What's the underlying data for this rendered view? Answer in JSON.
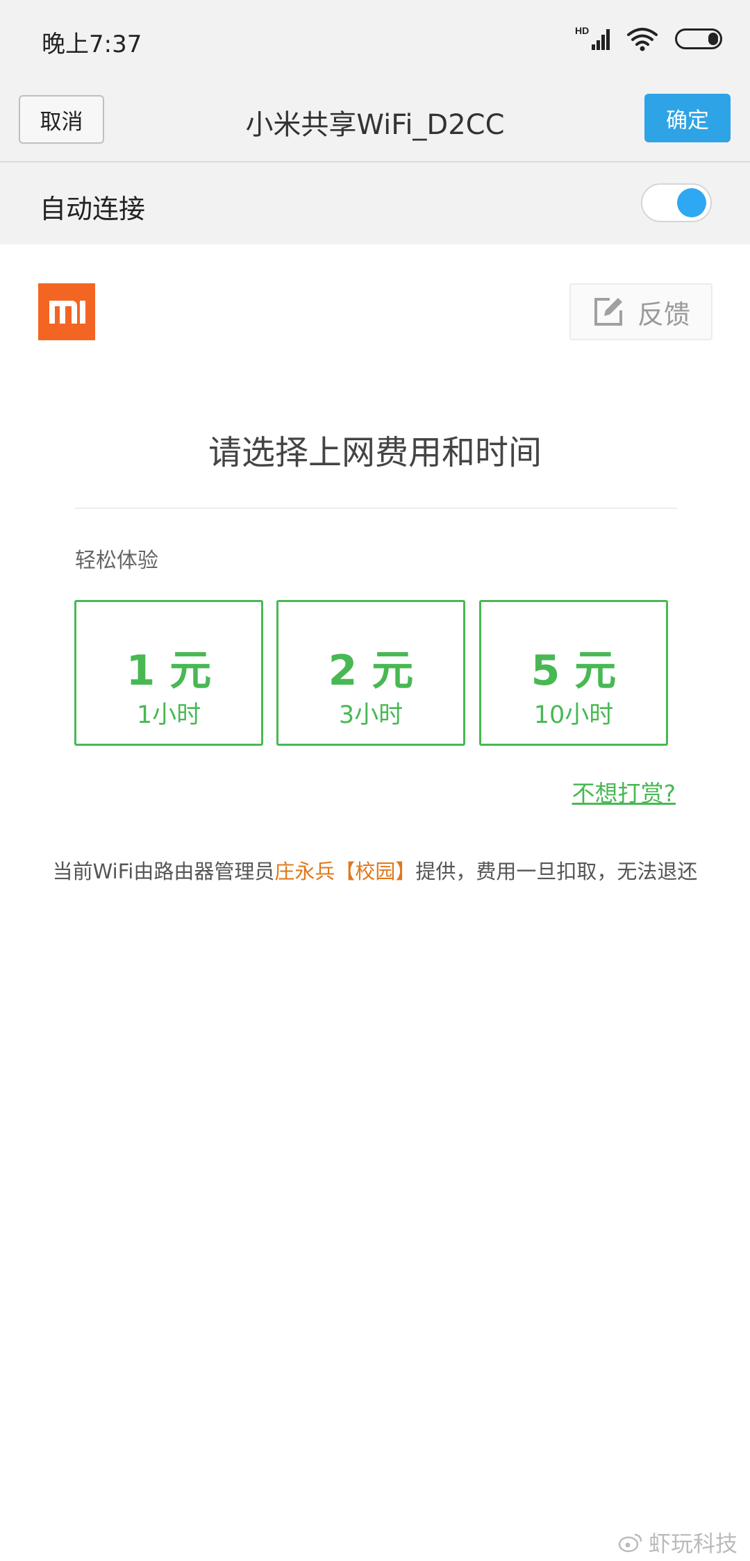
{
  "status_bar": {
    "time": "晚上7:37",
    "network_badge": "HD",
    "icons": [
      "signal-icon",
      "wifi-icon",
      "battery-icon"
    ]
  },
  "title_bar": {
    "cancel_label": "取消",
    "title": "小米共享WiFi_D2CC",
    "confirm_label": "确定"
  },
  "auto_connect": {
    "label": "自动连接",
    "enabled": true
  },
  "brand": {
    "logo_icon": "mi-logo-icon",
    "logo_color": "#f26522"
  },
  "feedback": {
    "label": "反馈",
    "icon": "edit-icon"
  },
  "headline": "请选择上网费用和时间",
  "section_label": "轻松体验",
  "plans": [
    {
      "price": "1 元",
      "duration": "1小时"
    },
    {
      "price": "2 元",
      "duration": "3小时"
    },
    {
      "price": "5 元",
      "duration": "10小时"
    }
  ],
  "no_reward_link": "不想打赏?",
  "notice": {
    "prefix": "当前WiFi由路由器管理员",
    "owner": "庄永兵【校园】",
    "suffix": "提供，费用一旦扣取，无法退还"
  },
  "watermark": "虾玩科技",
  "colors": {
    "accent_blue": "#2ea3e6",
    "plan_green": "#48b853",
    "highlight_orange": "#e0781a"
  }
}
